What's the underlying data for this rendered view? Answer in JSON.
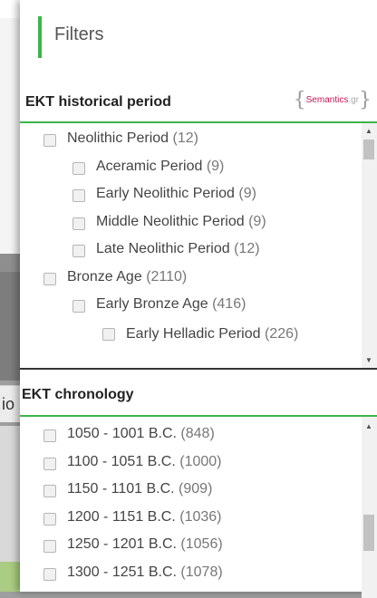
{
  "background": {
    "cut_text": "io"
  },
  "panel": {
    "title": "Filters",
    "historical": {
      "title": "EKT historical period",
      "logo_text": "Semantics",
      "logo_suffix": ".gr",
      "items": [
        {
          "label": "Neolithic Period",
          "count": "(12)",
          "level": 0
        },
        {
          "label": "Aceramic Period",
          "count": "(9)",
          "level": 1
        },
        {
          "label": "Early Neolithic Period",
          "count": "(9)",
          "level": 1
        },
        {
          "label": "Middle Neolithic Period",
          "count": "(9)",
          "level": 1
        },
        {
          "label": "Late Neolithic Period",
          "count": "(12)",
          "level": 1
        },
        {
          "label": "Bronze Age",
          "count": "(2110)",
          "level": 0
        },
        {
          "label": "Early Bronze Age",
          "count": "(416)",
          "level": 1
        },
        {
          "label": "Early Helladic Period",
          "count": "(226)",
          "level": 2
        }
      ]
    },
    "chronology": {
      "title": "EKT chronology",
      "items": [
        {
          "label": "1050 - 1001 B.C.",
          "count": "(848)"
        },
        {
          "label": "1100 - 1051 B.C.",
          "count": "(1000)"
        },
        {
          "label": "1150 - 1101 B.C.",
          "count": "(909)"
        },
        {
          "label": "1200 - 1151 B.C.",
          "count": "(1036)"
        },
        {
          "label": "1250 - 1201 B.C.",
          "count": "(1056)"
        },
        {
          "label": "1300 - 1251 B.C.",
          "count": "(1078)"
        }
      ]
    }
  },
  "colors": {
    "accent": "#3cb54a",
    "logo": "#c2185b"
  }
}
